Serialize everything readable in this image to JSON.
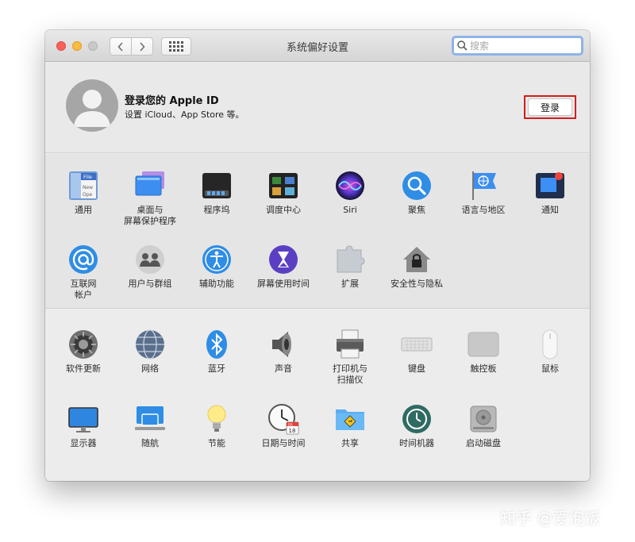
{
  "window": {
    "title": "系统偏好设置"
  },
  "search": {
    "placeholder": "搜索"
  },
  "account": {
    "title": "登录您的 Apple ID",
    "subtitle": "设置 iCloud、App Store 等。",
    "login_label": "登录"
  },
  "panes_row1": [
    {
      "label": "通用"
    },
    {
      "label": "桌面与\n屏幕保护程序"
    },
    {
      "label": "程序坞"
    },
    {
      "label": "调度中心"
    },
    {
      "label": "Siri"
    },
    {
      "label": "聚焦"
    },
    {
      "label": "语言与地区"
    },
    {
      "label": "通知"
    }
  ],
  "panes_row2": [
    {
      "label": "互联网\n帐户"
    },
    {
      "label": "用户与群组"
    },
    {
      "label": "辅助功能"
    },
    {
      "label": "屏幕使用时间"
    },
    {
      "label": "扩展"
    },
    {
      "label": "安全性与隐私"
    }
  ],
  "panes_row3": [
    {
      "label": "软件更新"
    },
    {
      "label": "网络"
    },
    {
      "label": "蓝牙"
    },
    {
      "label": "声音"
    },
    {
      "label": "打印机与\n扫描仪"
    },
    {
      "label": "键盘"
    },
    {
      "label": "触控板"
    },
    {
      "label": "鼠标"
    }
  ],
  "panes_row4": [
    {
      "label": "显示器"
    },
    {
      "label": "随航"
    },
    {
      "label": "节能"
    },
    {
      "label": "日期与时间"
    },
    {
      "label": "共享"
    },
    {
      "label": "时间机器"
    },
    {
      "label": "启动磁盘"
    }
  ],
  "icon_text": {
    "general_file": "File",
    "general_new": "New",
    "general_open": "Ope",
    "datetime_month": "JUL",
    "datetime_day": "18"
  },
  "watermark": "知乎 @爱泡饭",
  "colors": {
    "accent": "#2f7ae5",
    "highlight": "#d21d1d"
  }
}
